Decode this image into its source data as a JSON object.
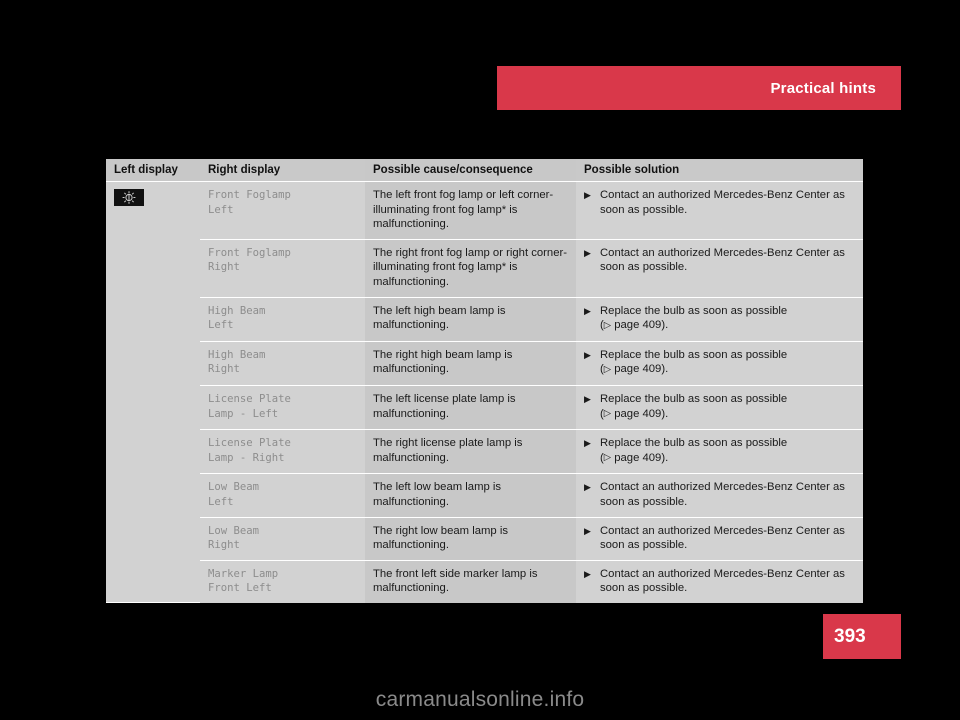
{
  "header": {
    "title": "Practical hints",
    "bar_color": "#d9384a"
  },
  "page": {
    "number": "393",
    "badge_color": "#d9384a"
  },
  "watermark": {
    "text": "carmanualsonline.info"
  },
  "table": {
    "columns": [
      {
        "key": "left_display",
        "label": "Left display"
      },
      {
        "key": "right_display",
        "label": "Right display"
      },
      {
        "key": "cause",
        "label": "Possible cause/consequence"
      },
      {
        "key": "solution",
        "label": "Possible solution"
      }
    ],
    "left_display_icon": {
      "name": "fog-lamp-warning-icon",
      "background": "#111111",
      "symbol_color": "#cfcfcf"
    },
    "bullet_glyph": "▶",
    "pageref_glyph": "▷",
    "rows": [
      {
        "right_display": "Front Foglamp\nLeft",
        "cause": "The left front fog lamp or left corner-illuminating front fog lamp* is malfunctioning.",
        "solution": "Contact an authorized Mercedes-Benz Center as soon as possible.",
        "pageref": ""
      },
      {
        "right_display": "Front Foglamp\nRight",
        "cause": "The right front fog lamp or right corner-illuminating front fog lamp* is malfunctioning.",
        "solution": "Contact an authorized Mercedes-Benz Center as soon as possible.",
        "pageref": ""
      },
      {
        "right_display": "High Beam\nLeft",
        "cause": "The left high beam lamp is malfunctioning.",
        "solution": "Replace the bulb as soon as possible",
        "pageref": "page 409)."
      },
      {
        "right_display": "High Beam\nRight",
        "cause": "The right high beam lamp is malfunctioning.",
        "solution": "Replace the bulb as soon as possible",
        "pageref": "page 409)."
      },
      {
        "right_display": "License Plate\nLamp - Left",
        "cause": "The left license plate lamp is malfunctioning.",
        "solution": "Replace the bulb as soon as possible",
        "pageref": "page 409)."
      },
      {
        "right_display": "License Plate\nLamp - Right",
        "cause": "The right license plate lamp is malfunctioning.",
        "solution": "Replace the bulb as soon as possible",
        "pageref": "page 409)."
      },
      {
        "right_display": "Low Beam\nLeft",
        "cause": "The left low beam lamp is malfunctioning.",
        "solution": "Contact an authorized Mercedes-Benz Center as soon as possible.",
        "pageref": ""
      },
      {
        "right_display": "Low Beam\nRight",
        "cause": "The right low beam lamp is malfunctioning.",
        "solution": "Contact an authorized Mercedes-Benz Center as soon as possible.",
        "pageref": ""
      },
      {
        "right_display": "Marker Lamp\nFront Left",
        "cause": "The front left side marker lamp is malfunctioning.",
        "solution": "Contact an authorized Mercedes-Benz Center as soon as possible.",
        "pageref": ""
      }
    ]
  }
}
